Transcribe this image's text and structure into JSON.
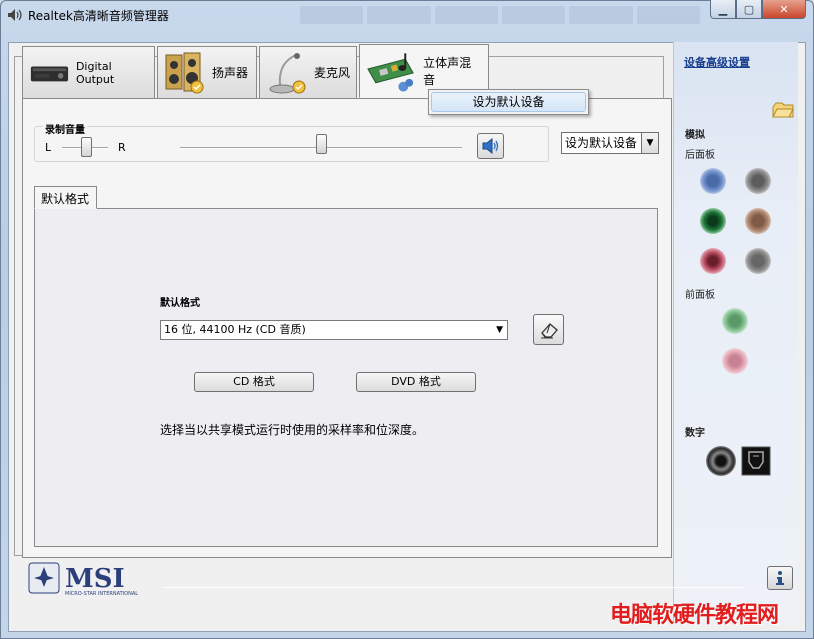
{
  "window": {
    "title": "Realtek高清晰音频管理器"
  },
  "tabs": [
    {
      "label": "Digital Output",
      "icon": "digital-output-device-icon"
    },
    {
      "label": "扬声器",
      "icon": "speakers-icon"
    },
    {
      "label": "麦克风",
      "icon": "microphone-icon"
    },
    {
      "label": "立体声混音",
      "icon": "sound-card-icon",
      "active": true
    }
  ],
  "context_menu": {
    "item": "设为默认设备"
  },
  "recording": {
    "volume_title": "录制音量",
    "left_label": "L",
    "right_label": "R",
    "balance": 0.5,
    "volume": 0.5,
    "set_default_value": "设为默认设备"
  },
  "format": {
    "tab_label": "默认格式",
    "section_label": "默认格式",
    "selected": "16 位, 44100 Hz (CD 音质)",
    "cd_button": "CD 格式",
    "dvd_button": "DVD 格式",
    "description": "选择当以共享模式运行时使用的采样率和位深度。"
  },
  "right_panel": {
    "advanced_link": "设备高级设置",
    "analog_label": "模拟",
    "rear_label": "后面板",
    "front_label": "前面板",
    "digital_label": "数字",
    "rear_jacks": [
      "#6f8fc8",
      "#8a8a8a",
      "#1b7a3a",
      "#b08870",
      "#c0546a",
      "#8f8f8f"
    ],
    "front_jacks": [
      "#7fbf8a",
      "#e3a7b4"
    ]
  },
  "footer": {
    "brand": "MSI",
    "brand_sub": "MICRO-STAR INTERNATIONAL"
  },
  "watermark": "电脑软硬件教程网"
}
